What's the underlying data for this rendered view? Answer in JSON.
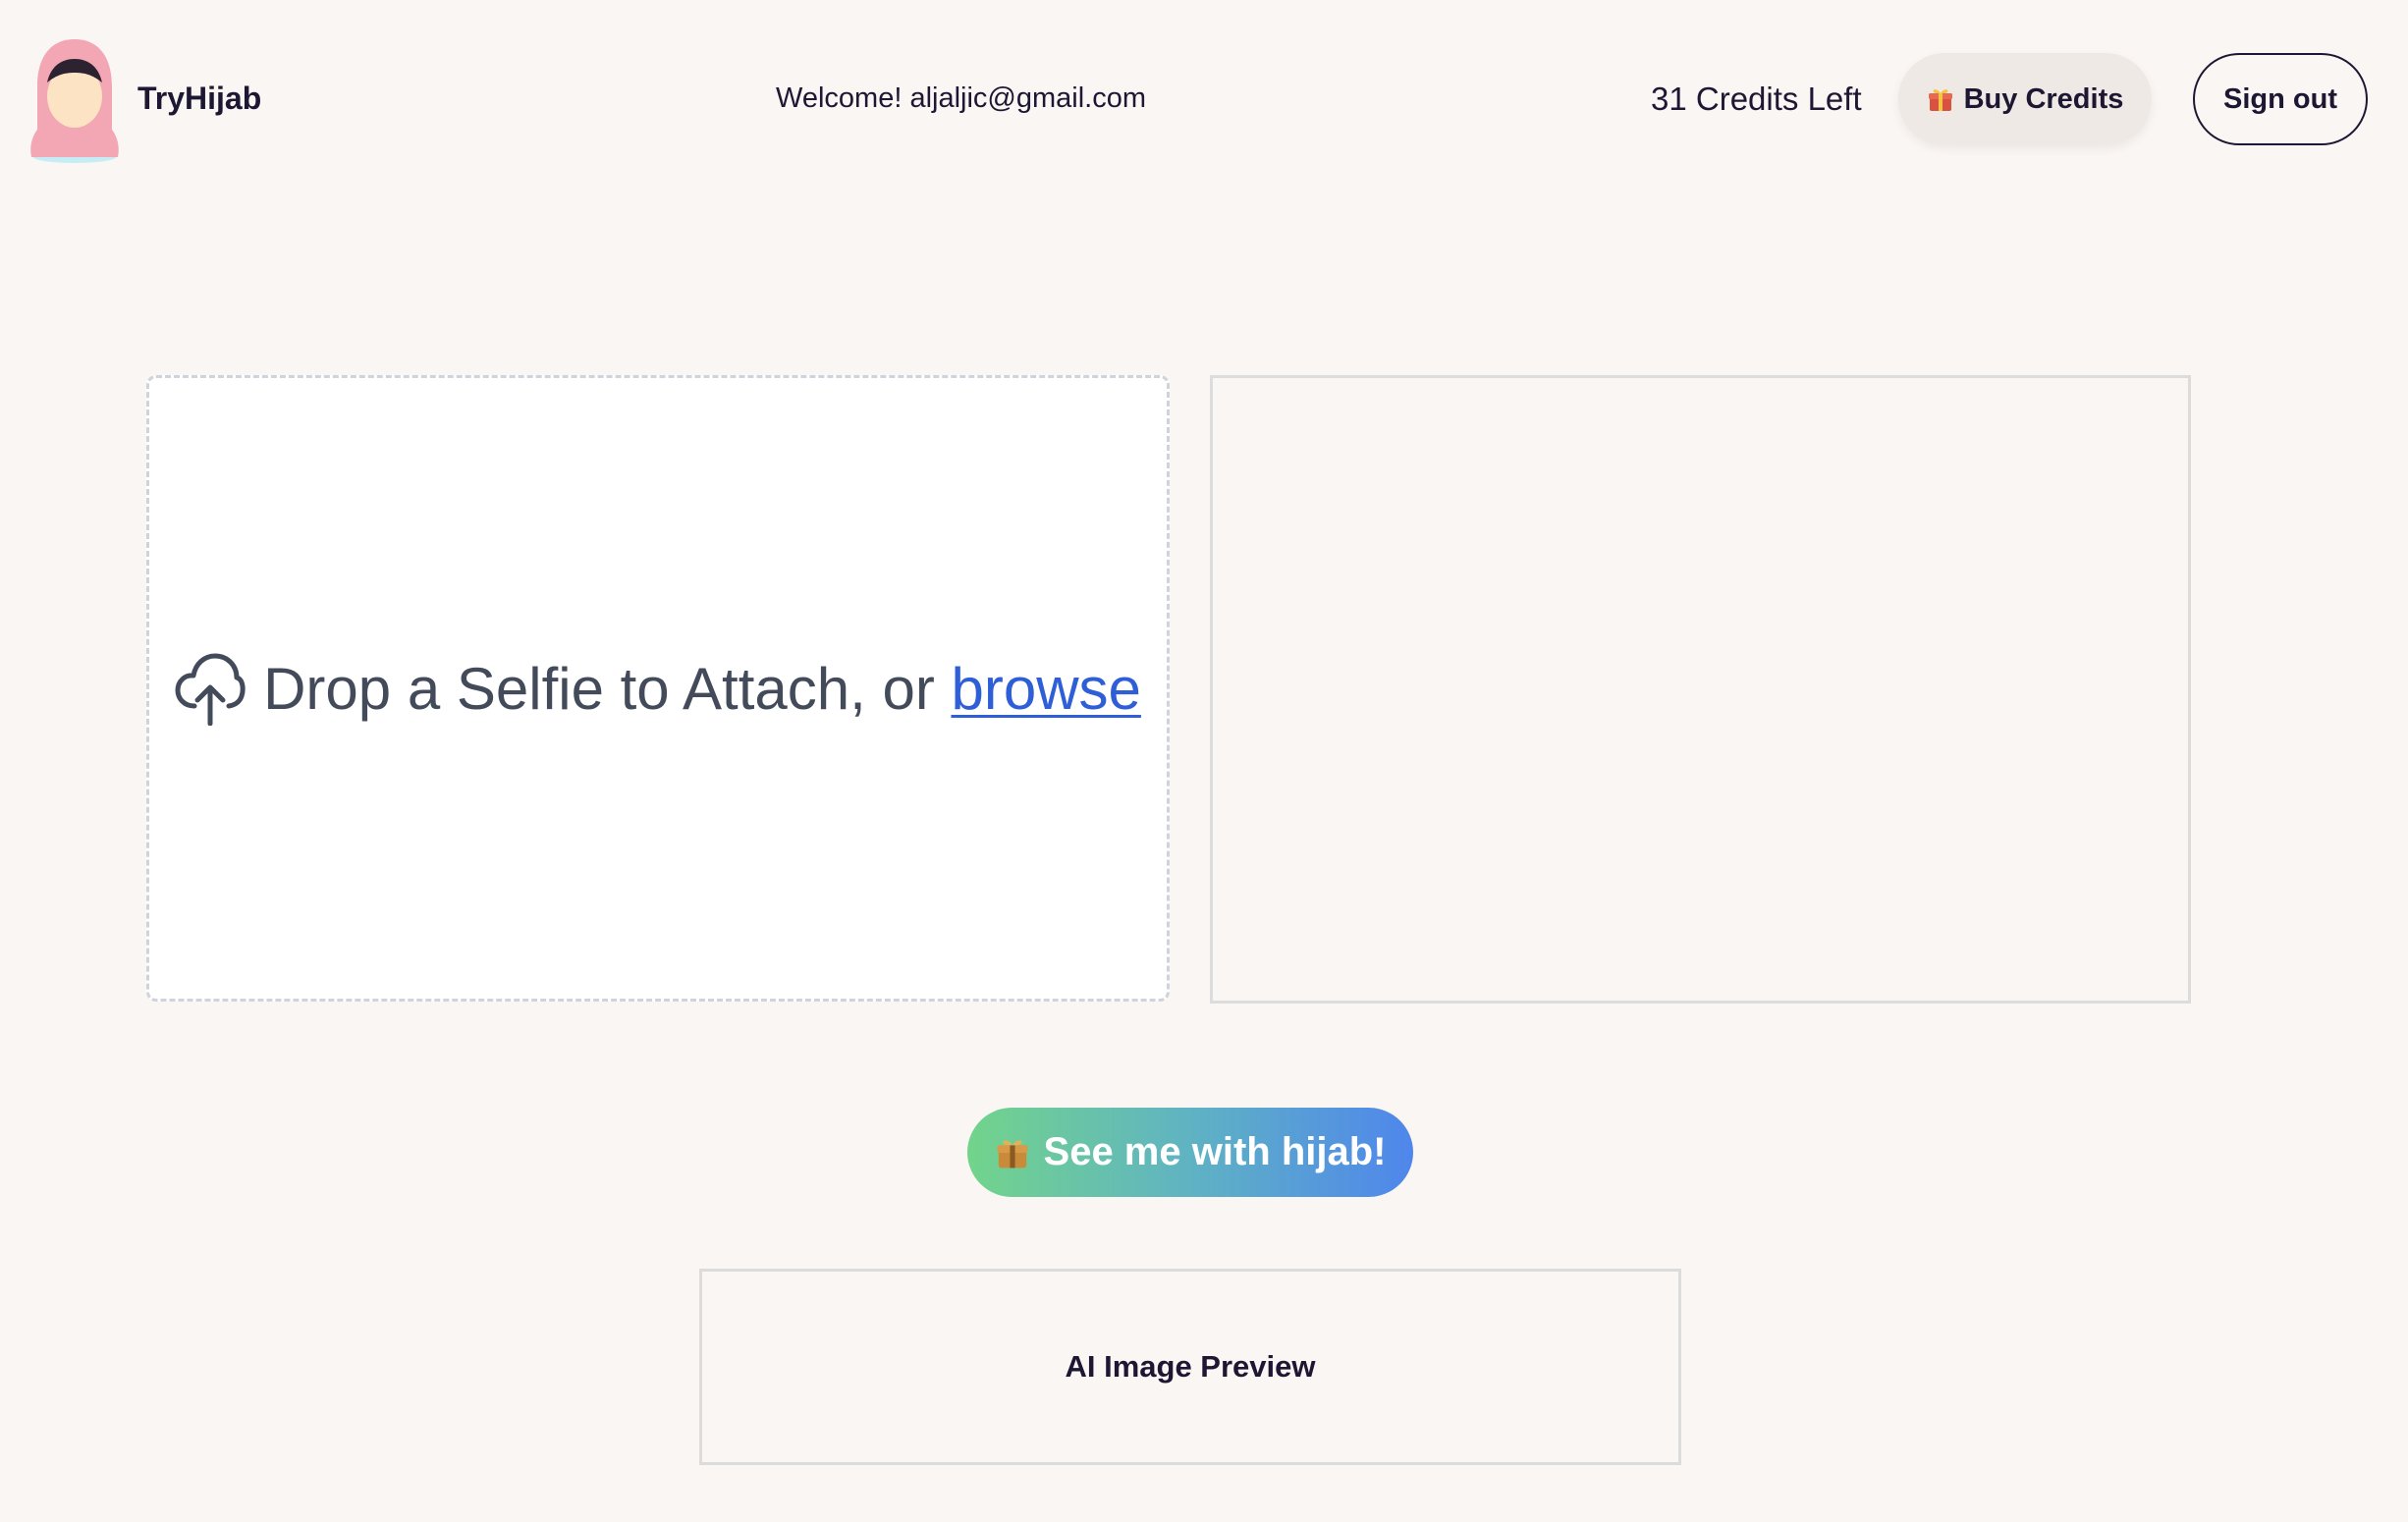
{
  "header": {
    "brand": "TryHijab",
    "welcome": "Welcome! aljaljic@gmail.com",
    "credits": "31 Credits Left",
    "buy_label": "Buy Credits",
    "signout_label": "Sign out"
  },
  "upload": {
    "prompt": "Drop a Selfie to Attach, or ",
    "browse_label": "browse",
    "icon": "cloud-upload-icon"
  },
  "action": {
    "cta_label": "See me with hijab!",
    "icon": "gift-icon"
  },
  "ai_preview": {
    "label": "AI Image Preview"
  },
  "colors": {
    "background": "#faf6f3",
    "link": "#2f5fd6",
    "cta_gradient_start": "#72d48b",
    "cta_gradient_end": "#4f86ec",
    "logo_hijab": "#f3a6b4"
  }
}
